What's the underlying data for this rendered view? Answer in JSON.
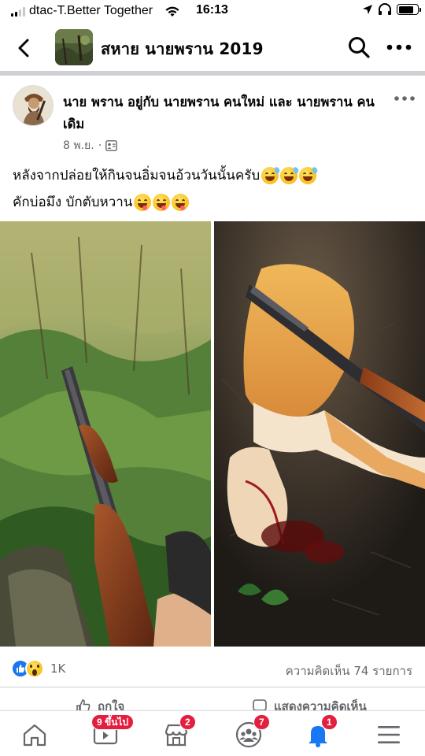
{
  "status_bar": {
    "carrier": "dtac-T.Better Together",
    "time": "16:13",
    "battery_level": 0.8
  },
  "header": {
    "title": "สหาย นายพราน 2019",
    "back_icon": "chevron-left-icon",
    "search_icon": "search-icon",
    "more_icon": "more-horizontal-icon"
  },
  "post": {
    "author_line": "นาย พราน อยู่กับ นายพราน คนใหม่ และ นายพราน คนเดิม",
    "timestamp": "8 พ.ย.",
    "separator": "·",
    "text_lines": [
      "หลังจากปล่อยให้กินจนอิ่มจนอ้วนวันนั้นครับ",
      "คักบ่อมึง บักตับหวาน"
    ],
    "reaction_count": "1K",
    "comment_count": "ความคิดเห็น 74 รายการ",
    "actions": {
      "like": "ถูกใจ",
      "comment": "แสดงความคิดเห็น"
    }
  },
  "bottom_nav": {
    "watch_badge": "9 ขึ้นไป",
    "marketplace_badge": "2",
    "groups_badge": "7",
    "notifications_badge": "1"
  },
  "colors": {
    "accent": "#1877f2",
    "badge": "#e41e3f",
    "muted_text": "#65676b"
  }
}
